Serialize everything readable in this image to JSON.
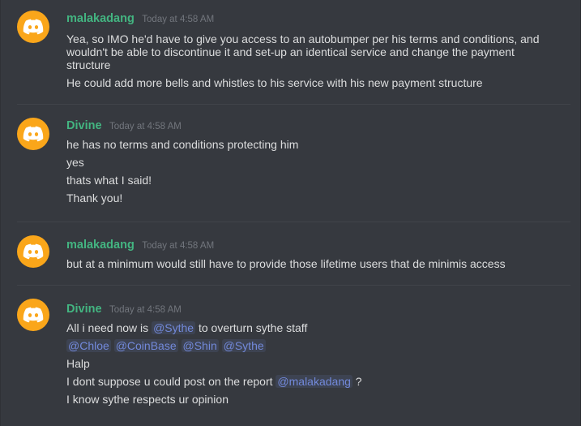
{
  "messages": [
    {
      "username": "malakadang",
      "timestamp": "Today at 4:58 AM",
      "lines": [
        "Yea, so IMO he'd have to give you access to an autobumper per his terms and conditions, and wouldn't be able to discontinue it and set-up an identical service and change the payment structure",
        "He could add more bells and whistles to his service with his new payment structure"
      ]
    },
    {
      "username": "Divine",
      "timestamp": "Today at 4:58 AM",
      "lines": [
        "he has no terms and conditions protecting him",
        "yes",
        "thats what I said!",
        "Thank you!"
      ]
    },
    {
      "username": "malakadang",
      "timestamp": "Today at 4:58 AM",
      "lines": [
        "but at a minimum would still have to provide those lifetime users that de minimis access"
      ]
    },
    {
      "username": "Divine",
      "timestamp": "Today at 4:58 AM",
      "line1_pre": "All i need now is",
      "line1_mention": "@Sythe",
      "line1_post": "to overturn sythe staff",
      "line2_mentions": [
        "@Chloe",
        "@CoinBase",
        "@Shin",
        "@Sythe"
      ],
      "line3": "Halp",
      "line4_pre": "I dont suppose u could post on the report",
      "line4_mention": "@malakadang",
      "line4_post": "?",
      "line5": "I know sythe respects ur opinion"
    }
  ],
  "colors": {
    "background": "#36393f",
    "username": "#43b581",
    "timestamp": "#72767d",
    "text": "#dcddde",
    "mention": "#7289da",
    "avatar": "#faa61a"
  },
  "icons": {
    "avatar": "discord-logo-icon"
  }
}
